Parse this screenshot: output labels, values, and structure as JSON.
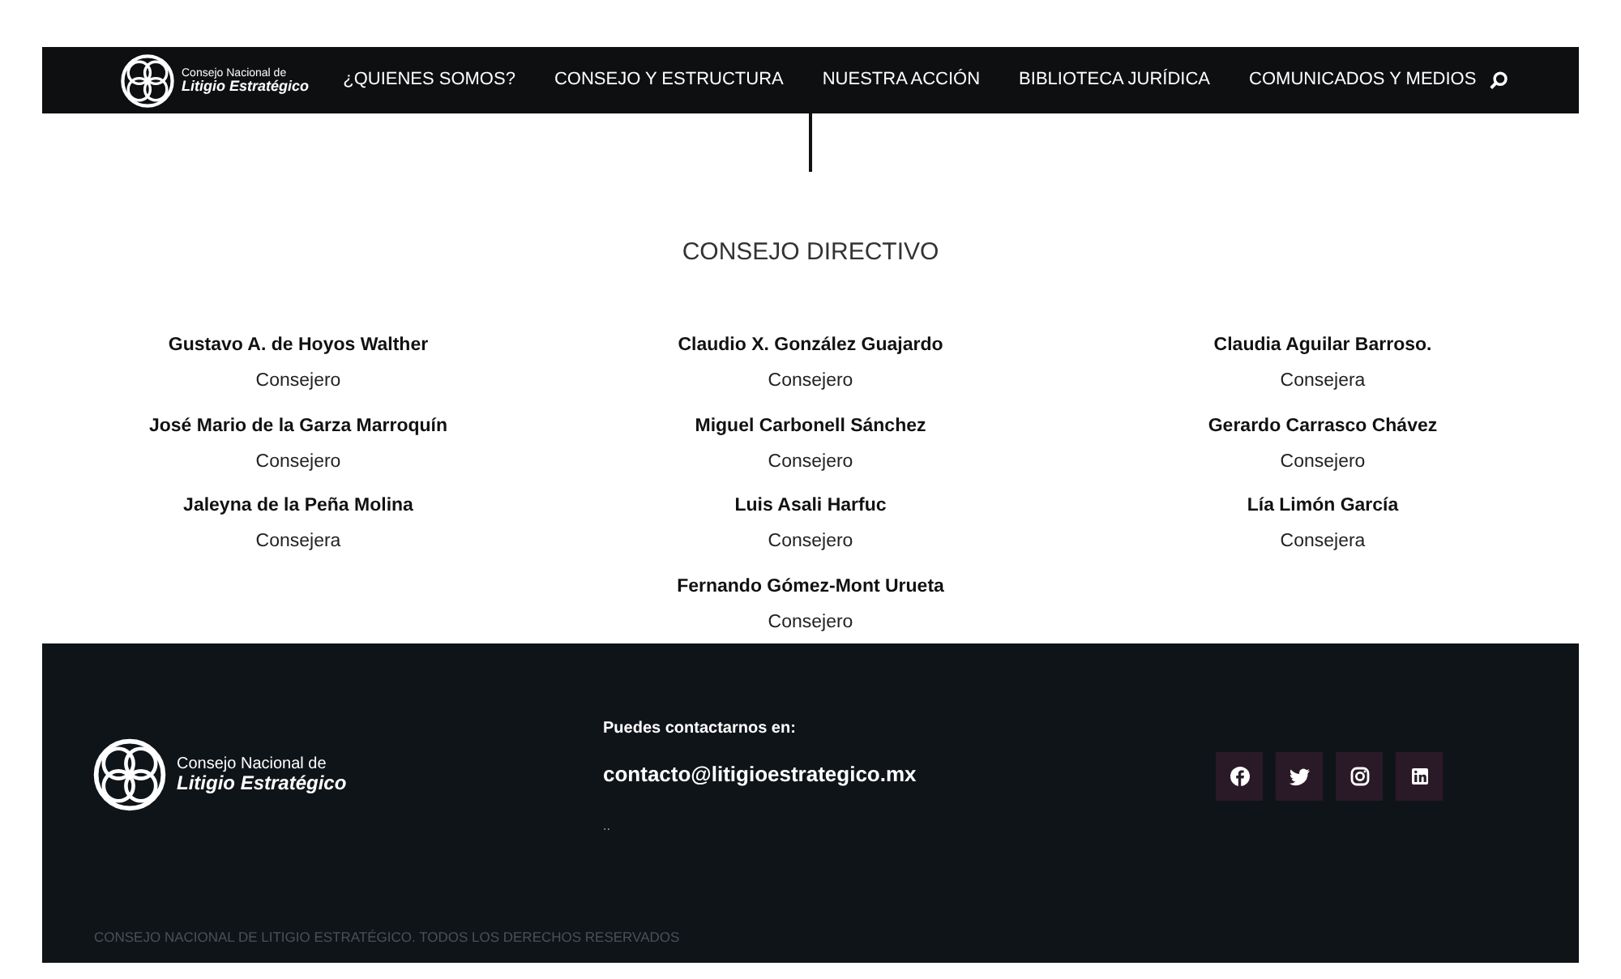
{
  "nav": {
    "logo": {
      "line1": "Consejo Nacional de",
      "line2": "Litigio Estratégico"
    },
    "items": [
      {
        "label": "¿QUIENES SOMOS?"
      },
      {
        "label": "CONSEJO Y ESTRUCTURA"
      },
      {
        "label": "NUESTRA ACCIÓN"
      },
      {
        "label": "BIBLIOTECA JURÍDICA"
      },
      {
        "label": "COMUNICADOS Y MEDIOS"
      }
    ]
  },
  "section": {
    "title": "CONSEJO DIRECTIVO",
    "columns": [
      [
        {
          "name": "Gustavo A. de Hoyos Walther",
          "role": "Consejero"
        },
        {
          "name": "José Mario de la Garza Marroquín",
          "role": "Consejero"
        },
        {
          "name": "Jaleyna de la Peña Molina",
          "role": "Consejera"
        }
      ],
      [
        {
          "name": "Claudio X. González Guajardo",
          "role": "Consejero"
        },
        {
          "name": "Miguel Carbonell Sánchez",
          "role": "Consejero"
        },
        {
          "name": "Luis Asali Harfuc",
          "role": "Consejero"
        },
        {
          "name": "Fernando Gómez-Mont Urueta",
          "role": "Consejero"
        }
      ],
      [
        {
          "name": "Claudia Aguilar Barroso.",
          "role": "Consejera"
        },
        {
          "name": "Gerardo Carrasco Chávez",
          "role": "Consejero"
        },
        {
          "name": "Lía Limón García",
          "role": "Consejera"
        }
      ]
    ]
  },
  "footer": {
    "logo": {
      "line1": "Consejo Nacional de",
      "line2": "Litigio Estratégico"
    },
    "contact_label": "Puedes contactarnos en:",
    "email": "contacto@litigioestrategico.mx",
    "note": "..",
    "social": [
      {
        "kind": "facebook"
      },
      {
        "kind": "twitter"
      },
      {
        "kind": "instagram"
      },
      {
        "kind": "linkedin"
      }
    ],
    "copyright": "CONSEJO NACIONAL DE LITIGIO ESTRATÉGICO. TODOS LOS DERECHOS RESERVADOS"
  }
}
